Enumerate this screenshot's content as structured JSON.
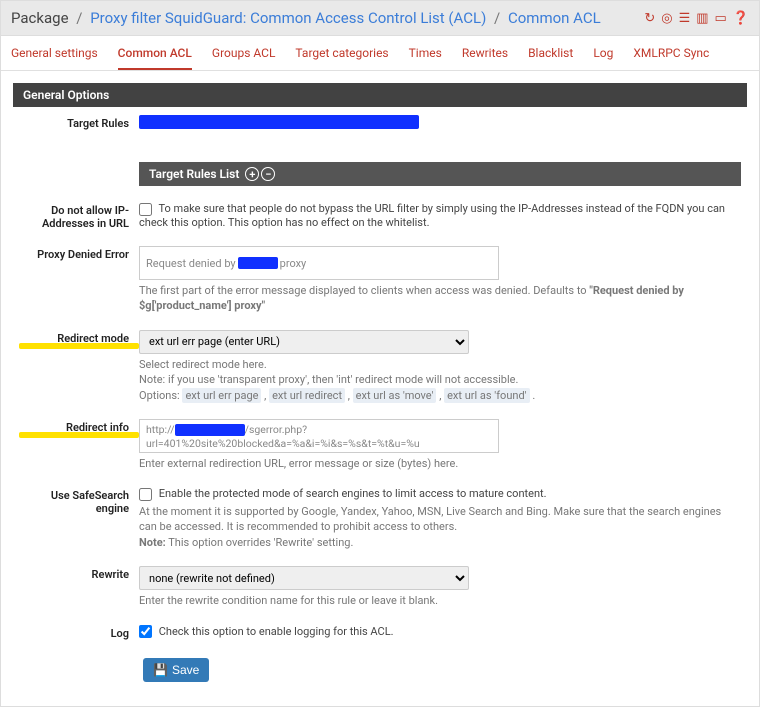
{
  "breadcrumb": {
    "root": "Package",
    "mid": "Proxy filter SquidGuard: Common Access Control List (ACL)",
    "leaf": "Common ACL"
  },
  "toolbar_icons": [
    "refresh-icon",
    "target-icon",
    "sliders-icon",
    "chart-icon",
    "card-icon",
    "help-icon"
  ],
  "tabs": [
    {
      "id": "general",
      "label": "General settings"
    },
    {
      "id": "common",
      "label": "Common ACL",
      "active": true
    },
    {
      "id": "groups",
      "label": "Groups ACL"
    },
    {
      "id": "targets",
      "label": "Target categories"
    },
    {
      "id": "times",
      "label": "Times"
    },
    {
      "id": "rewrites",
      "label": "Rewrites"
    },
    {
      "id": "blacklist",
      "label": "Blacklist"
    },
    {
      "id": "log",
      "label": "Log"
    },
    {
      "id": "xmlrpc",
      "label": "XMLRPC Sync"
    }
  ],
  "panel": {
    "title": "General Options",
    "sub_title": "Target Rules List"
  },
  "rows": {
    "target_rules": {
      "label": "Target Rules"
    },
    "no_ip": {
      "label": "Do not allow IP-Addresses in URL",
      "checked": false,
      "text": "To make sure that people do not bypass the URL filter by simply using the IP-Addresses instead of the FQDN you can check this option. This option has no effect on the whitelist."
    },
    "proxy_denied": {
      "label": "Proxy Denied Error",
      "value_pre": "Request denied by ",
      "value_post": " proxy",
      "help_pre": "The first part of the error message displayed to clients when access was denied. Defaults to ",
      "help_bold": "\"Request denied by $g['product_name'] proxy\""
    },
    "redirect_mode": {
      "label": "Redirect mode",
      "selected": "ext url err page (enter URL)",
      "help1": "Select redirect mode here.",
      "help2": "Note: if you use 'transparent proxy', then 'int' redirect mode will not accessible.",
      "help3_pre": "Options:",
      "opts": [
        "ext url err page",
        "ext url redirect",
        "ext url as 'move'",
        "ext url as 'found'"
      ]
    },
    "redirect_info": {
      "label": "Redirect info",
      "value_pre": "http://",
      "value_post": "/sgerror.php?url=401%20site%20blocked&a=%a&i=%i&s=%s&t=%t&u=%u",
      "help": "Enter external redirection URL, error message or size (bytes) here."
    },
    "safesearch": {
      "label": "Use SafeSearch engine",
      "checked": false,
      "text": "Enable the protected mode of search engines to limit access to mature content.",
      "help1": "At the moment it is supported by Google, Yandex, Yahoo, MSN, Live Search and Bing. Make sure that the search engines can be accessed. It is recommended to prohibit access to others.",
      "help2_bold": "Note:",
      "help2_rest": " This option overrides 'Rewrite' setting."
    },
    "rewrite": {
      "label": "Rewrite",
      "selected": "none (rewrite not defined)",
      "help": "Enter the rewrite condition name for this rule or leave it blank."
    },
    "log": {
      "label": "Log",
      "checked": true,
      "text": "Check this option to enable logging for this ACL."
    }
  },
  "save_btn": "Save"
}
